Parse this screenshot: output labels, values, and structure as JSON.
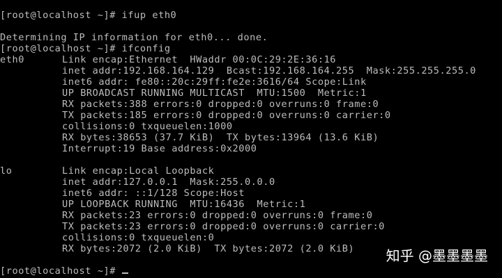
{
  "terminal": {
    "cmd_ifup_line": "[root@localhost ~]# ifup eth0",
    "dhcp_line": "Determining IP information for eth0... done.",
    "cmd_ifconfig_line": "[root@localhost ~]# ifconfig",
    "eth0": {
      "name": "eth0",
      "lines": [
        "Link encap:Ethernet  HWaddr 00:0C:29:2E:36:16",
        "inet addr:192.168.164.129  Bcast:192.168.164.255  Mask:255.255.255.0",
        "inet6 addr: fe80::20c:29ff:fe2e:3616/64 Scope:Link",
        "UP BROADCAST RUNNING MULTICAST  MTU:1500  Metric:1",
        "RX packets:388 errors:0 dropped:0 overruns:0 frame:0",
        "TX packets:185 errors:0 dropped:0 overruns:0 carrier:0",
        "collisions:0 txqueuelen:1000",
        "RX bytes:38653 (37.7 KiB)  TX bytes:13964 (13.6 KiB)",
        "Interrupt:19 Base address:0x2000"
      ]
    },
    "lo": {
      "name": "lo",
      "lines": [
        "Link encap:Local Loopback",
        "inet addr:127.0.0.1  Mask:255.0.0.0",
        "inet6 addr: ::1/128 Scope:Host",
        "UP LOOPBACK RUNNING  MTU:16436  Metric:1",
        "RX packets:23 errors:0 dropped:0 overruns:0 frame:0",
        "TX packets:23 errors:0 dropped:0 overruns:0 carrier:0",
        "collisions:0 txqueuelen:0",
        "RX bytes:2072 (2.0 KiB)  TX bytes:2072 (2.0 KiB)"
      ]
    },
    "final_prompt": "[root@localhost ~]# "
  },
  "watermark": "知乎 @墨墨墨墨",
  "colors": {
    "background": "#000000",
    "text": "#bdbdbd",
    "watermark": "#ffffff"
  }
}
